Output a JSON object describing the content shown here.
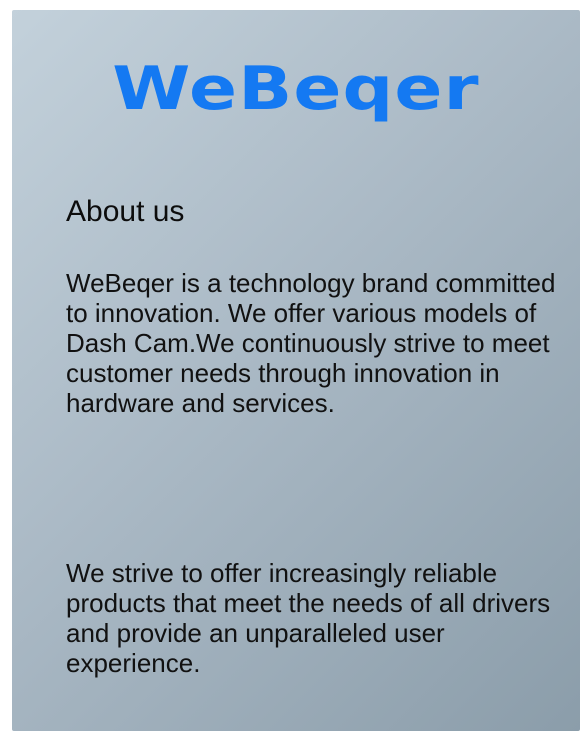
{
  "brand": {
    "logo_text": "WeBeqer",
    "logo_color": "#1479f2"
  },
  "about": {
    "title": "About us",
    "paragraph_1": "WeBeqer is a technology brand committed to innovation. We offer various models of Dash Cam.We continuously strive to meet customer needs through innovation in hardware and services.",
    "paragraph_2": "We strive to offer increasingly reliable products that meet the needs of all drivers and provide an unparalleled user experience."
  }
}
